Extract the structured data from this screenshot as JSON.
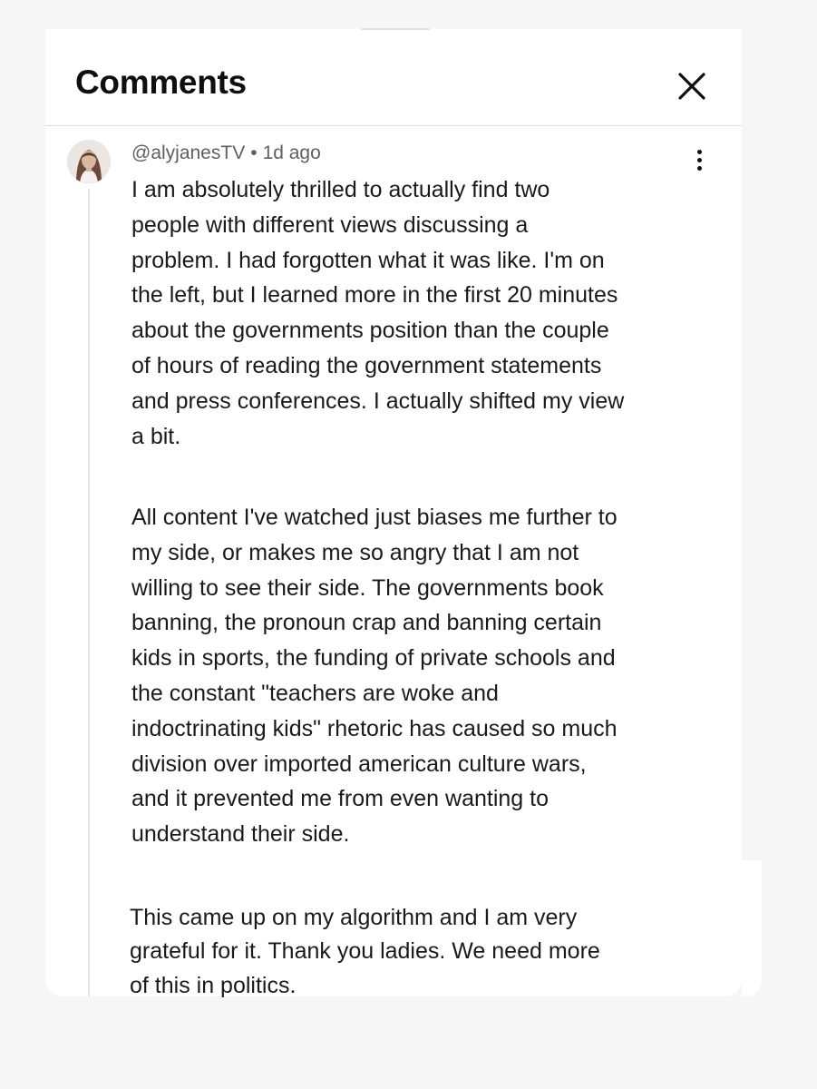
{
  "header": {
    "title": "Comments"
  },
  "comment": {
    "author": "@alyjanesTV",
    "separator": "•",
    "time": "1d ago",
    "paragraphs": [
      [
        "I am absolutely thrilled to actually find two",
        "people with different views discussing a",
        "problem. I had forgotten what it was like. I'm on",
        "the left, but I learned more in the first 20 minutes",
        "about the governments position than the couple",
        "of hours of reading the government statements",
        "and press conferences. I actually shifted my view",
        "a bit."
      ],
      [
        "All content I've watched just biases me further to",
        "my side, or makes me so angry that I am not",
        "willing to see their side. The governments book",
        "banning, the pronoun crap and banning certain",
        "kids in sports, the funding of private schools and",
        "the constant \"teachers are woke and",
        "indoctrinating kids\" rhetoric has caused so much",
        "division over imported american culture wars,",
        "and it prevented me from even wanting to",
        "understand their side."
      ],
      [
        "This came up on my algorithm and I am very",
        "grateful for it. Thank you ladies. We need more",
        "of this in politics."
      ]
    ]
  },
  "icons": {
    "close": "close-icon",
    "more": "more-vert-icon",
    "avatar": "avatar"
  }
}
